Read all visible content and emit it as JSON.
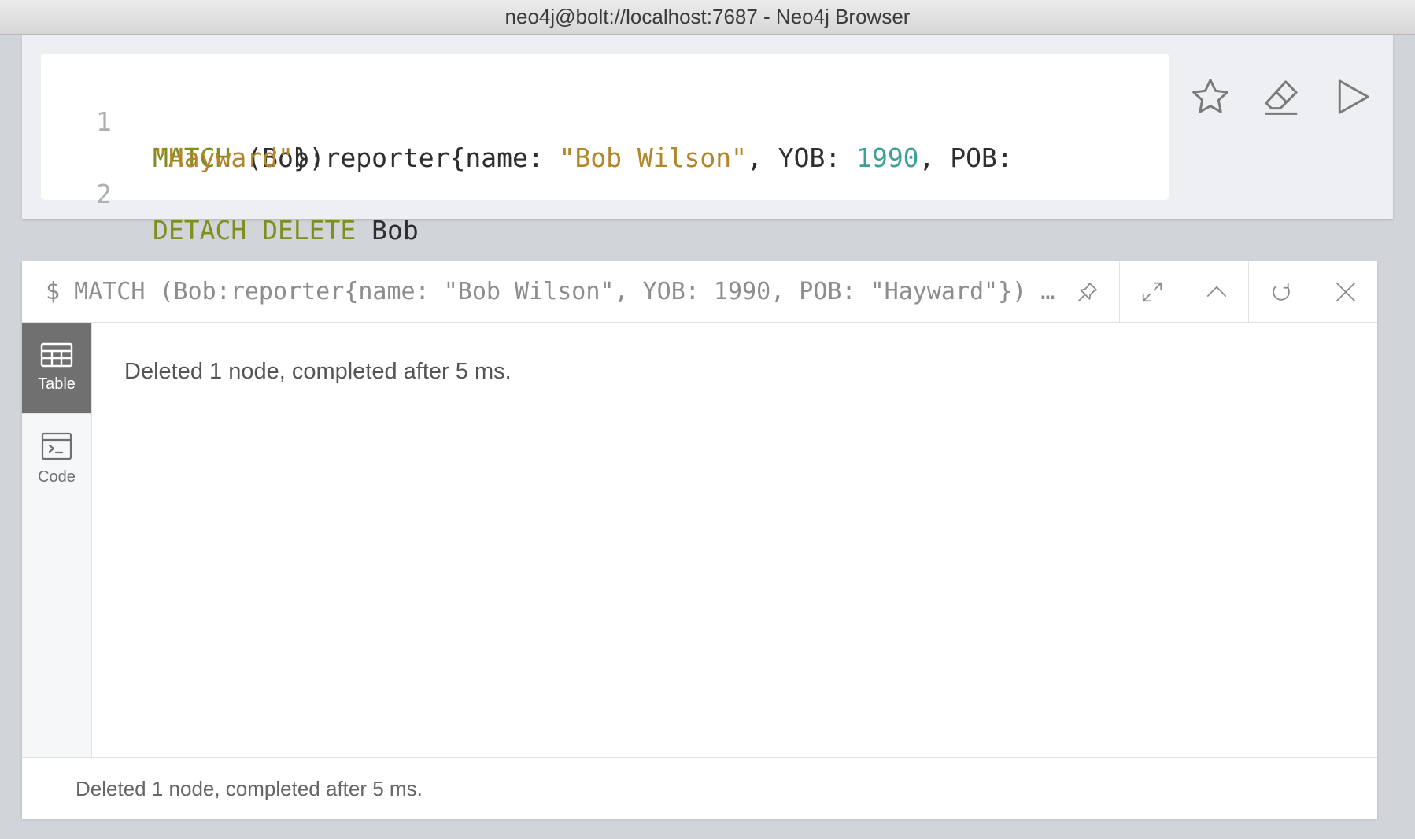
{
  "window": {
    "title": "neo4j@bolt://localhost:7687 - Neo4j Browser"
  },
  "editor": {
    "lines": [
      {
        "number": "1",
        "tokens": [
          {
            "text": "MATCH",
            "kind": "kw"
          },
          {
            "text": " (Bob:reporter{name: ",
            "kind": "plain"
          },
          {
            "text": "\"Bob Wilson\"",
            "kind": "str"
          },
          {
            "text": ", YOB: ",
            "kind": "plain"
          },
          {
            "text": "1990",
            "kind": "num"
          },
          {
            "text": ", POB:",
            "kind": "plain"
          }
        ],
        "continuation": [
          {
            "text": "\"Hayward\"",
            "kind": "str"
          },
          {
            "text": "})",
            "kind": "plain"
          }
        ]
      },
      {
        "number": "2",
        "tokens": [
          {
            "text": "DETACH DELETE",
            "kind": "kw"
          },
          {
            "text": " Bob",
            "kind": "plain"
          }
        ]
      }
    ],
    "actions": [
      {
        "name": "favorite-star-icon",
        "label": "favorite"
      },
      {
        "name": "clear-eraser-icon",
        "label": "clear"
      },
      {
        "name": "run-play-icon",
        "label": "run"
      }
    ]
  },
  "frame": {
    "command": "$ MATCH (Bob:reporter{name: \"Bob Wilson\", YOB: 1990, POB: \"Hayward\"}) DETACH DELETE Bob",
    "buttons": [
      "pin-icon",
      "expand-icon",
      "collapse-up-icon",
      "rerun-icon",
      "close-icon"
    ],
    "tabs": [
      {
        "label": "Table",
        "icon": "table-icon",
        "active": true
      },
      {
        "label": "Code",
        "icon": "code-terminal-icon",
        "active": false
      }
    ],
    "message": "Deleted 1 node, completed after 5 ms.",
    "status": "Deleted 1 node, completed after 5 ms."
  },
  "colors": {
    "keyword": "#7f8f1f",
    "string": "#b4862b",
    "number": "#3ea09a",
    "active_tab": "#707070"
  }
}
